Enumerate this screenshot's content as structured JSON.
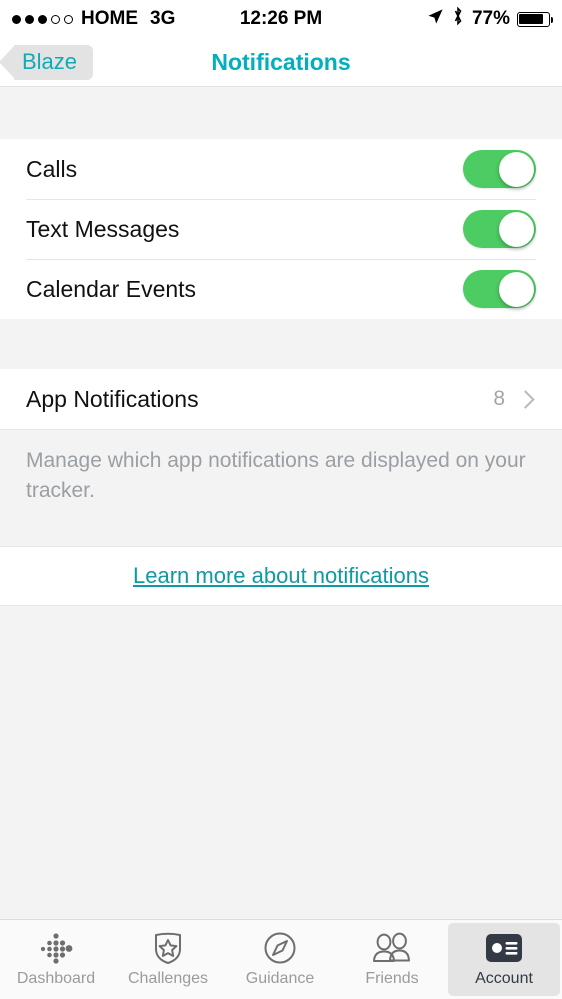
{
  "status_bar": {
    "signal_filled": 3,
    "signal_empty": 2,
    "carrier": "HOME",
    "network": "3G",
    "time": "12:26 PM",
    "location_icon": "location-arrow-icon",
    "bluetooth_icon": "bluetooth-icon",
    "battery_percent": "77%",
    "battery_level": 77
  },
  "nav": {
    "back_label": "Blaze",
    "title": "Notifications"
  },
  "settings": {
    "rows": [
      {
        "label": "Calls",
        "toggle": "on"
      },
      {
        "label": "Text Messages",
        "toggle": "on"
      },
      {
        "label": "Calendar Events",
        "toggle": "on"
      }
    ]
  },
  "app_notifications": {
    "label": "App Notifications",
    "value": "8",
    "chevron_icon": "chevron-right-icon"
  },
  "note": {
    "text": "Manage which app notifications are displayed on your tracker."
  },
  "link": {
    "label": "Learn more about notifications"
  },
  "tab_bar": {
    "tabs": [
      {
        "label": "Dashboard",
        "icon": "fitbit-dots-icon",
        "active": false
      },
      {
        "label": "Challenges",
        "icon": "shield-star-icon",
        "active": false
      },
      {
        "label": "Guidance",
        "icon": "compass-icon",
        "active": false
      },
      {
        "label": "Friends",
        "icon": "two-people-icon",
        "active": false
      },
      {
        "label": "Account",
        "icon": "id-card-icon",
        "active": true
      }
    ]
  },
  "colors": {
    "teal": "#00b0bd",
    "toggle_green": "#4ccc62",
    "link_teal": "#0f9aa3",
    "tab_active_fill": "#333a45",
    "tab_inactive": "#9b9b9b"
  }
}
